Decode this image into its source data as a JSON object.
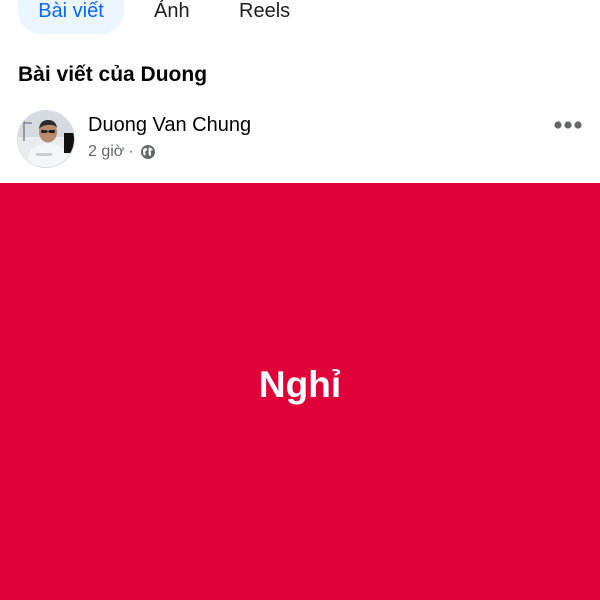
{
  "tabs": [
    {
      "label": "Bài viết",
      "active": true
    },
    {
      "label": "Ảnh",
      "active": false
    },
    {
      "label": "Reels",
      "active": false
    }
  ],
  "section_title": "Bài viết của Duong",
  "post": {
    "author": "Duong Van Chung",
    "time": "2 giờ",
    "separator": "·",
    "privacy_icon": "globe-icon",
    "more_icon": "more-horizontal-icon",
    "text": "Nghỉ",
    "background_color": "#e0003a",
    "text_color": "#ffffff"
  },
  "colors": {
    "accent": "#0866ff",
    "active_tab_bg": "#ebf5ff",
    "secondary_text": "#65676b"
  }
}
